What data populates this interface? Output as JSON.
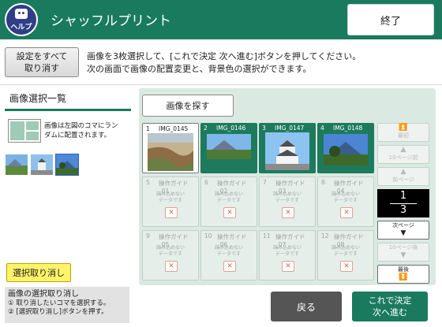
{
  "header": {
    "help_label": "ヘルプ",
    "title": "シャッフルプリント",
    "end_label": "終了"
  },
  "toolbar": {
    "cancel_all_label": "設定をすべて\n取り消す",
    "instructions": "画像を3枚選択して、[これで決定 次へ進む]ボタンを押してください。\n次の画面で画像の配置変更と、背景色の選択ができます。"
  },
  "left_panel": {
    "title": "画像選択一覧",
    "layout_note": "画像は左図のコマにラン\nダムに配置されます。",
    "clear_selection_label": "選択取り消し",
    "help_title": "画像の選択取り消し",
    "help_steps": [
      "① 取り消したいコマを選択する。",
      "② [選択取り消し]ボタンを押す。"
    ]
  },
  "grid": {
    "search_label": "画像を探す",
    "cells": [
      {
        "num": "1",
        "name": "IMG_0145",
        "state": "current"
      },
      {
        "num": "2",
        "name": "IMG_0146",
        "state": "selected"
      },
      {
        "num": "3",
        "name": "IMG_0147",
        "state": "selected"
      },
      {
        "num": "4",
        "name": "IMG_0148",
        "state": "selected"
      },
      {
        "num": "5",
        "name": "操作ガイド_01",
        "state": "error",
        "error_text": "読み込めない\nデータです"
      },
      {
        "num": "6",
        "name": "操作ガイド_02",
        "state": "error",
        "error_text": "読み込めない\nデータです"
      },
      {
        "num": "7",
        "name": "操作ガイド_03",
        "state": "error",
        "error_text": "読み込めない\nデータです"
      },
      {
        "num": "8",
        "name": "操作ガイド_04",
        "state": "error",
        "error_text": "読み込めない\nデータです"
      },
      {
        "num": "9",
        "name": "操作ガイド_05",
        "state": "error",
        "error_text": "読み込めない\nデータです"
      },
      {
        "num": "10",
        "name": "操作ガイド_06",
        "state": "error",
        "error_text": "読み込めない\nデータです"
      },
      {
        "num": "11",
        "name": "操作ガイド_07",
        "state": "error",
        "error_text": "読み込めない\nデータです"
      },
      {
        "num": "12",
        "name": "操作ガイド_08",
        "state": "error",
        "error_text": "読み込めない\nデータです"
      }
    ]
  },
  "pager": {
    "first": "最初",
    "back10": "10ページ前",
    "prev": "前ページ",
    "current_page": "1",
    "total_pages": "3",
    "next": "次ページ",
    "fwd10": "10ページ後",
    "last": "最後"
  },
  "footer": {
    "back_label": "戻る",
    "next_label": "これで決定\n次へ進む"
  },
  "colors": {
    "brand": "#1a7a5e",
    "selected_cell": "#1d7a5d",
    "clear_button": "#fff36a",
    "back_button": "#555555"
  }
}
